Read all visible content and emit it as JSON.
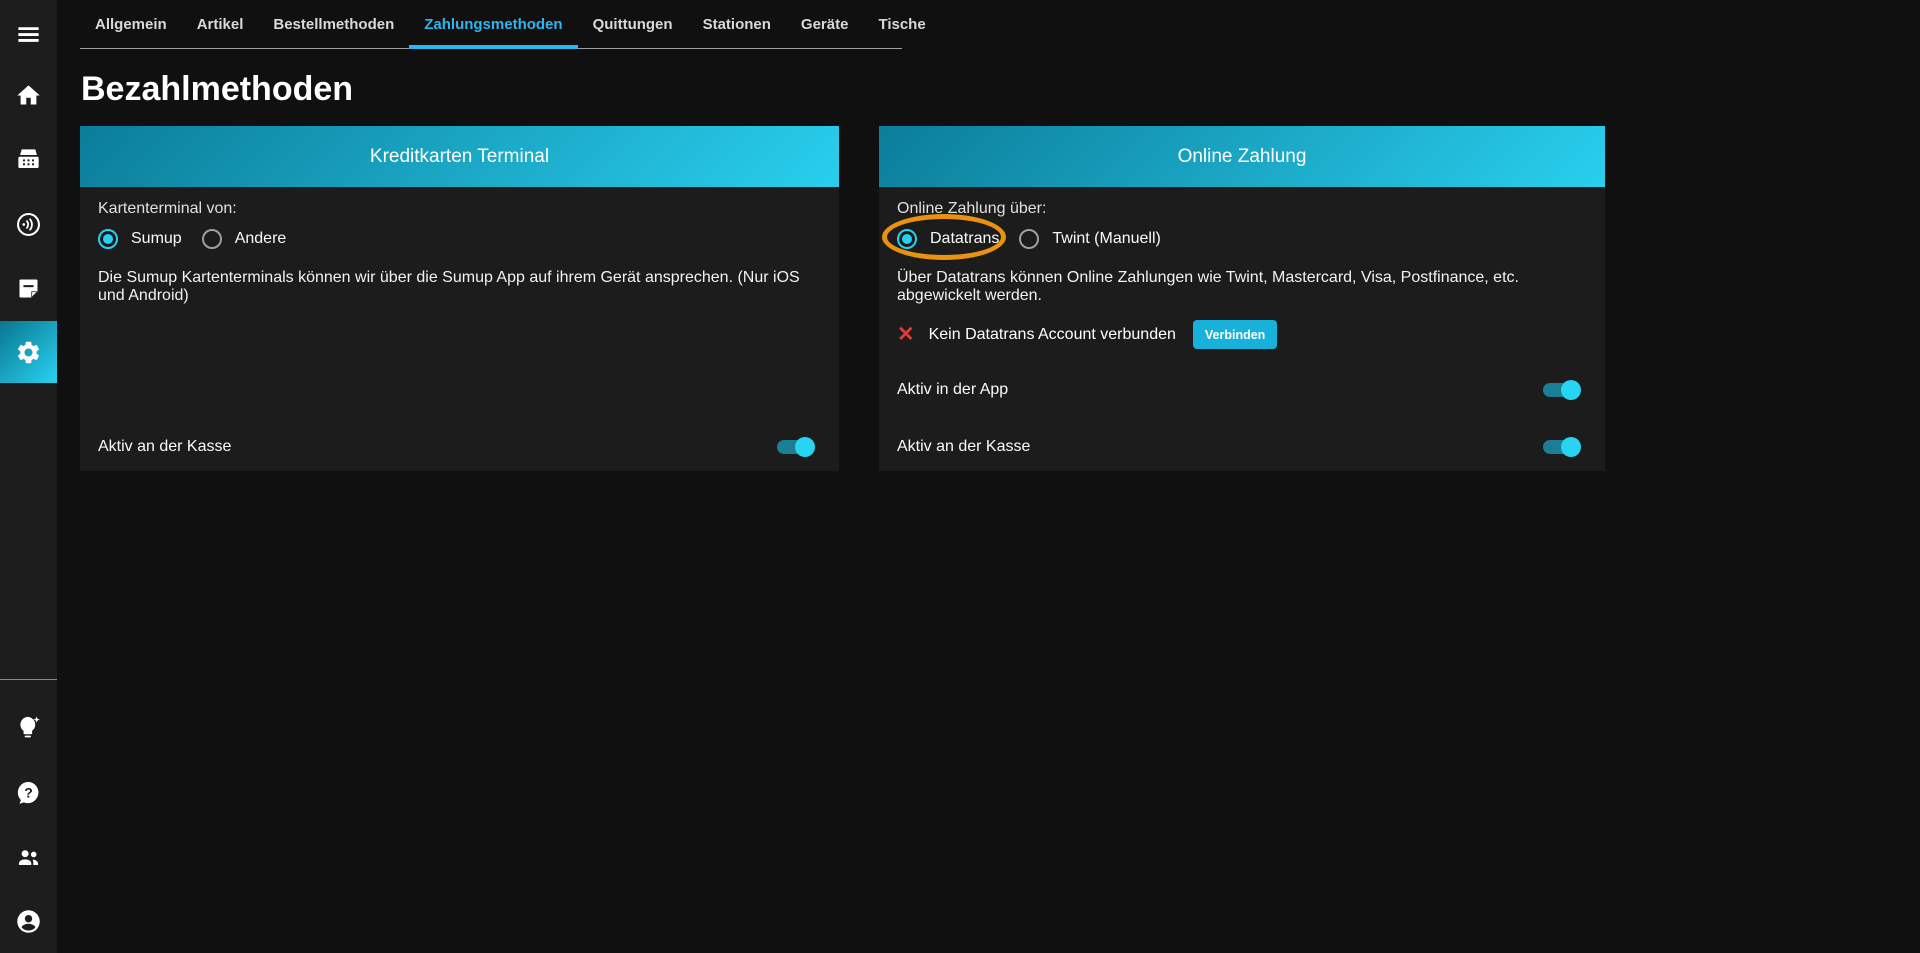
{
  "colors": {
    "accent_cyan": "#29d4f2",
    "tab_active": "#2db5ef",
    "header_gradient_start": "#0b7d99",
    "header_gradient_end": "#29cfee",
    "button_bg": "#18b1d9",
    "error_red": "#e03a34",
    "annotation_orange": "#e8920f",
    "sidebar_bg": "#1d1d1d",
    "card_bg": "#1c1c1c",
    "page_bg": "#101010"
  },
  "sidebar": {
    "items": [
      {
        "icon": "hamburger-menu-icon"
      },
      {
        "icon": "home-icon"
      },
      {
        "icon": "cash-register-icon"
      },
      {
        "icon": "contactless-icon"
      },
      {
        "icon": "note-icon"
      },
      {
        "icon": "gear-icon",
        "active": true
      },
      {
        "icon": "lightbulb-sparkle-icon"
      },
      {
        "icon": "help-icon"
      },
      {
        "icon": "users-icon"
      },
      {
        "icon": "account-icon"
      }
    ]
  },
  "tabs": [
    {
      "label": "Allgemein",
      "active": false
    },
    {
      "label": "Artikel",
      "active": false
    },
    {
      "label": "Bestellmethoden",
      "active": false
    },
    {
      "label": "Zahlungsmethoden",
      "active": true
    },
    {
      "label": "Quittungen",
      "active": false
    },
    {
      "label": "Stationen",
      "active": false
    },
    {
      "label": "Geräte",
      "active": false
    },
    {
      "label": "Tische",
      "active": false
    }
  ],
  "page": {
    "title": "Bezahlmethoden"
  },
  "cards": {
    "terminal": {
      "header": "Kreditkarten Terminal",
      "field_label": "Kartenterminal von:",
      "options": [
        {
          "label": "Sumup",
          "selected": true
        },
        {
          "label": "Andere",
          "selected": false
        }
      ],
      "description": "Die Sumup Kartenterminals können wir über die Sumup App auf ihrem Gerät ansprechen. (Nur iOS und Android)",
      "toggles": [
        {
          "label": "Aktiv an der Kasse",
          "on": true
        }
      ]
    },
    "online": {
      "header": "Online Zahlung",
      "field_label": "Online Zahlung über:",
      "options": [
        {
          "label": "Datatrans",
          "selected": true,
          "annotated": true
        },
        {
          "label": "Twint (Manuell)",
          "selected": false
        }
      ],
      "description": "Über Datatrans können Online Zahlungen wie Twint, Mastercard, Visa, Postfinance, etc. abgewickelt werden.",
      "status": {
        "icon": "error-x-icon",
        "text": "Kein Datatrans Account verbunden",
        "button": "Verbinden"
      },
      "toggles": [
        {
          "label": "Aktiv in der App",
          "on": true
        },
        {
          "label": "Aktiv an der Kasse",
          "on": true
        }
      ]
    }
  }
}
